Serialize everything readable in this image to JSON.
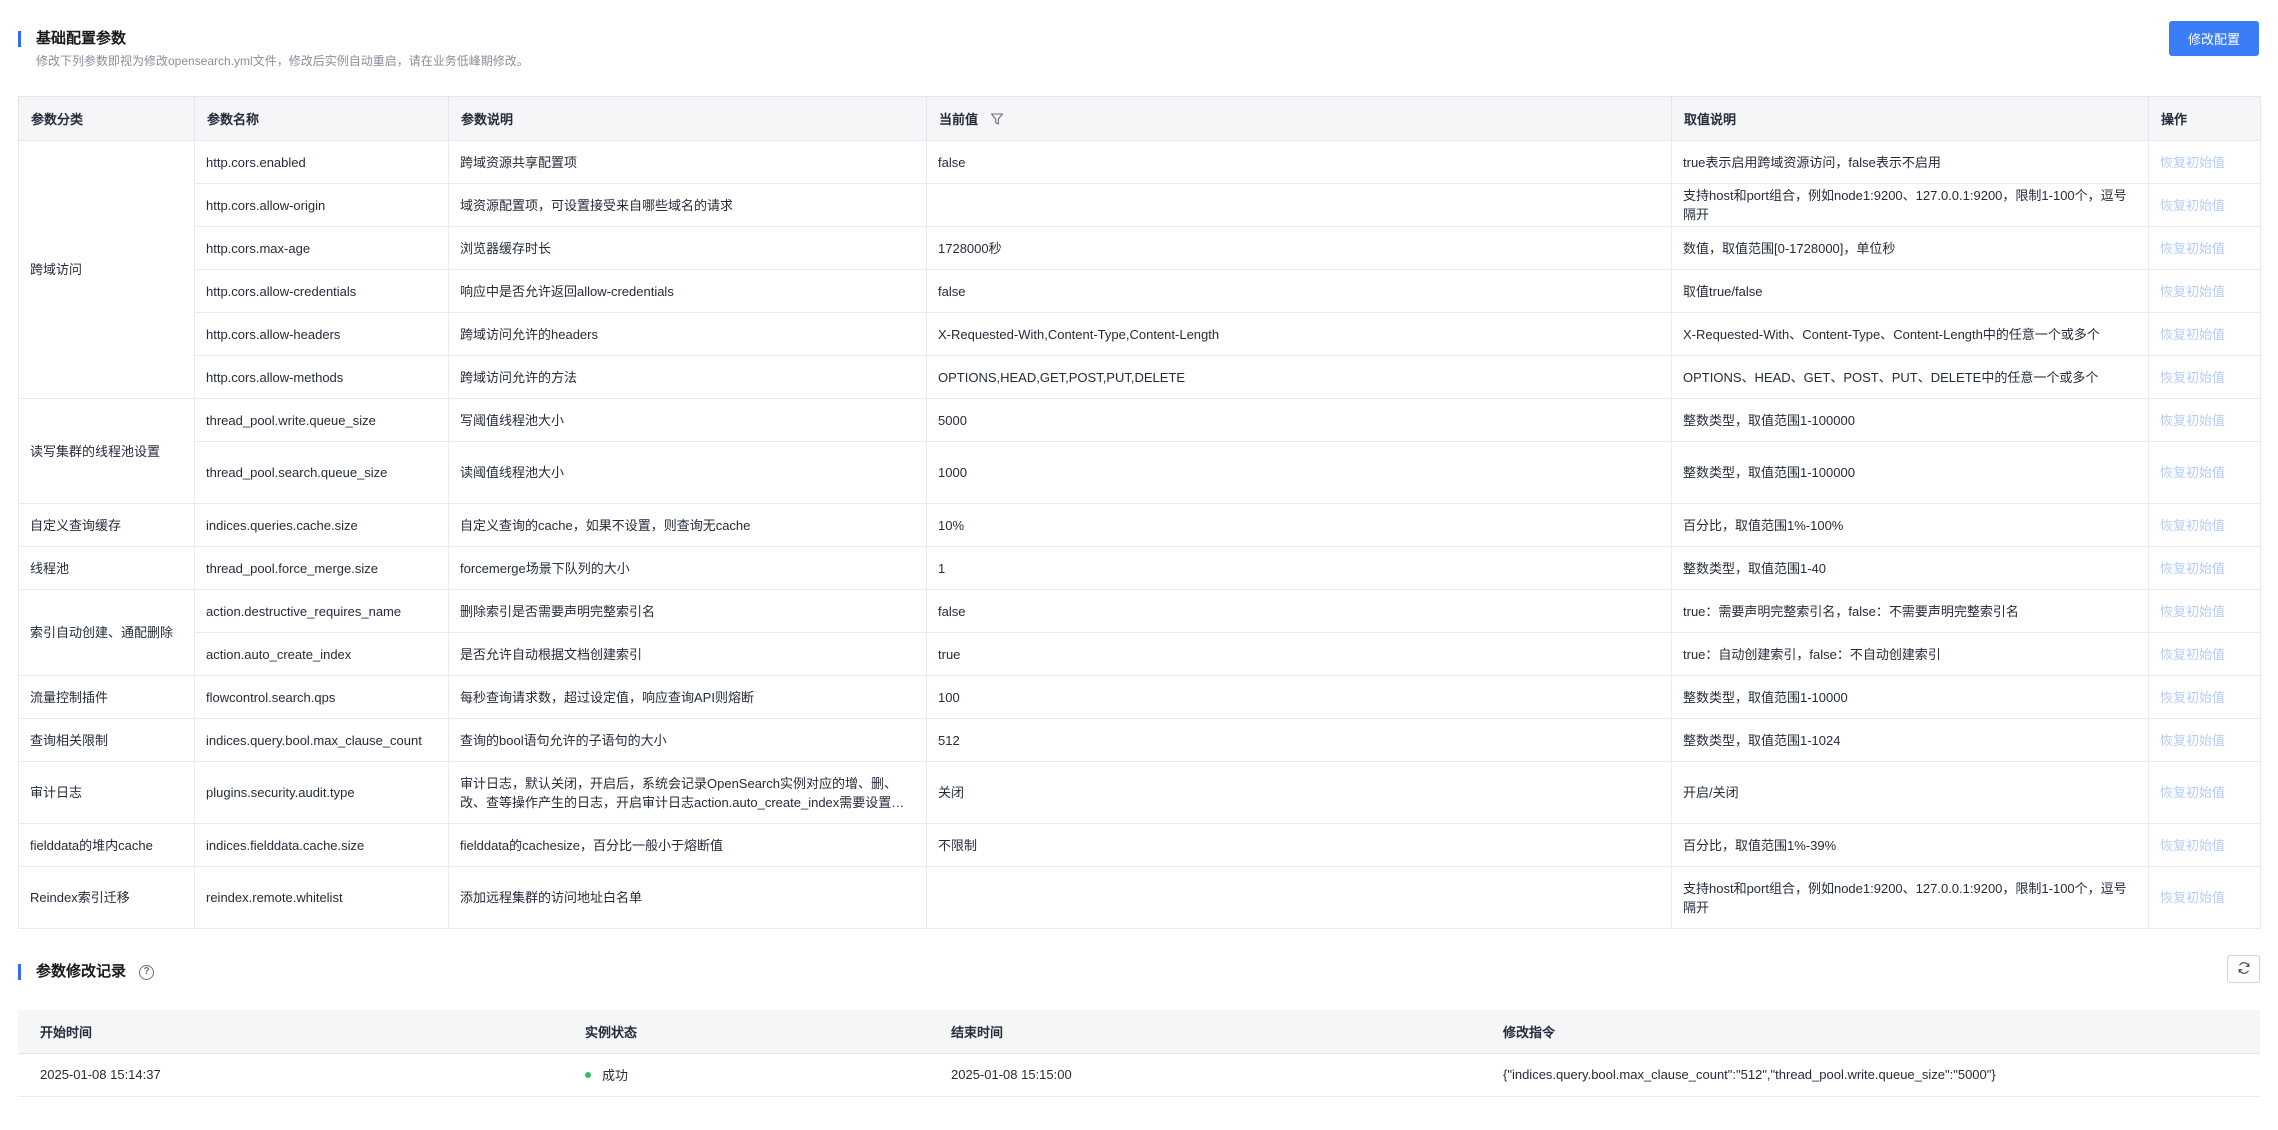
{
  "header": {
    "title": "基础配置参数",
    "description": "修改下列参数即视为修改opensearch.yml文件，修改后实例自动重启，请在业务低峰期修改。",
    "modify_button": "修改配置"
  },
  "config_table": {
    "columns": [
      "参数分类",
      "参数名称",
      "参数说明",
      "当前值",
      "取值说明",
      "操作"
    ],
    "reset_label": "恢复初始值",
    "groups": [
      {
        "category": "跨域访问",
        "rows": [
          {
            "name": "http.cors.enabled",
            "desc": "跨域资源共享配置项",
            "value": "false",
            "range": "true表示启用跨域资源访问，false表示不启用"
          },
          {
            "name": "http.cors.allow-origin",
            "desc": "域资源配置项，可设置接受来自哪些域名的请求",
            "value": "",
            "range": "支持host和port组合，例如node1:9200、127.0.0.1:9200，限制1-100个，逗号隔开"
          },
          {
            "name": "http.cors.max-age",
            "desc": "浏览器缓存时长",
            "value": "1728000秒",
            "range": "数值，取值范围[0-1728000]，单位秒"
          },
          {
            "name": "http.cors.allow-credentials",
            "desc": "响应中是否允许返回allow-credentials",
            "value": "false",
            "range": "取值true/false"
          },
          {
            "name": "http.cors.allow-headers",
            "desc": "跨域访问允许的headers",
            "value": "X-Requested-With,Content-Type,Content-Length",
            "range": "X-Requested-With、Content-Type、Content-Length中的任意一个或多个"
          },
          {
            "name": "http.cors.allow-methods",
            "desc": "跨域访问允许的方法",
            "value": "OPTIONS,HEAD,GET,POST,PUT,DELETE",
            "range": "OPTIONS、HEAD、GET、POST、PUT、DELETE中的任意一个或多个"
          }
        ]
      },
      {
        "category": "读写集群的线程池设置",
        "rows": [
          {
            "name": "thread_pool.write.queue_size",
            "desc": "写阈值线程池大小",
            "value": "5000",
            "range": "整数类型，取值范围1-100000"
          },
          {
            "name": "thread_pool.search.queue_size",
            "desc": "读阈值线程池大小",
            "value": "1000",
            "range": "整数类型，取值范围1-100000"
          }
        ]
      },
      {
        "category": "自定义查询缓存",
        "rows": [
          {
            "name": "indices.queries.cache.size",
            "desc": "自定义查询的cache，如果不设置，则查询无cache",
            "value": "10%",
            "range": "百分比，取值范围1%-100%"
          }
        ]
      },
      {
        "category": "线程池",
        "rows": [
          {
            "name": "thread_pool.force_merge.size",
            "desc": "forcemerge场景下队列的大小",
            "value": "1",
            "range": "整数类型，取值范围1-40"
          }
        ]
      },
      {
        "category": "索引自动创建、通配删除",
        "rows": [
          {
            "name": "action.destructive_requires_name",
            "desc": "删除索引是否需要声明完整索引名",
            "value": "false",
            "range": "true：需要声明完整索引名，false：不需要声明完整索引名"
          },
          {
            "name": "action.auto_create_index",
            "desc": "是否允许自动根据文档创建索引",
            "value": "true",
            "range": "true：自动创建索引，false：不自动创建索引"
          }
        ]
      },
      {
        "category": "流量控制插件",
        "rows": [
          {
            "name": "flowcontrol.search.qps",
            "desc": "每秒查询请求数，超过设定值，响应查询API则熔断",
            "value": "100",
            "range": "整数类型，取值范围1-10000"
          }
        ]
      },
      {
        "category": "查询相关限制",
        "rows": [
          {
            "name": "indices.query.bool.max_clause_count",
            "desc": "查询的bool语句允许的子语句的大小",
            "value": "512",
            "range": "整数类型，取值范围1-1024"
          }
        ]
      },
      {
        "category": "审计日志",
        "rows": [
          {
            "name": "plugins.security.audit.type",
            "desc": "审计日志，默认关闭，开启后，系统会记录OpenSearch实例对应的增、删、改、查等操作产生的日志，开启审计日志action.auto_create_index需要设置为true",
            "value": "关闭",
            "range": "开启/关闭"
          }
        ]
      },
      {
        "category": "fielddata的堆内cache",
        "rows": [
          {
            "name": "indices.fielddata.cache.size",
            "desc": "fielddata的cachesize，百分比一般小于熔断值",
            "value": "不限制",
            "range": "百分比，取值范围1%-39%"
          }
        ]
      },
      {
        "category": "Reindex索引迁移",
        "rows": [
          {
            "name": "reindex.remote.whitelist",
            "desc": "添加远程集群的访问地址白名单",
            "value": "",
            "range": "支持host和port组合，例如node1:9200、127.0.0.1:9200，限制1-100个，逗号隔开"
          }
        ]
      }
    ]
  },
  "log_section": {
    "title": "参数修改记录",
    "help_icon": "?",
    "columns": [
      "开始时间",
      "实例状态",
      "结束时间",
      "修改指令"
    ],
    "rows": [
      {
        "start": "2025-01-08 15:14:37",
        "status": "成功",
        "end": "2025-01-08 15:15:00",
        "command": "{\"indices.query.bool.max_clause_count\":\"512\",\"thread_pool.write.queue_size\":\"5000\"}"
      }
    ]
  },
  "colors": {
    "accent": "#3b7cf7",
    "success": "#3dbb6c",
    "link_disabled": "#b6cdf6"
  }
}
